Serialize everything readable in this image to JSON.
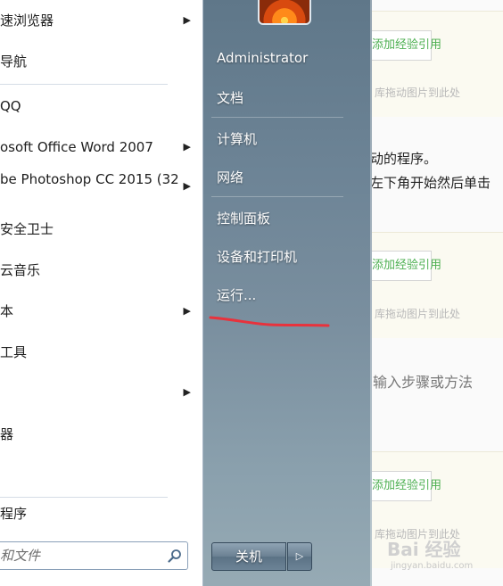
{
  "background": {
    "add_experience_label": "添加经验引用",
    "drag_hint": "库拖动图片到此处",
    "step1_line1": "在运行启动的程序。",
    "step1_line2": "单击桌面左下角开始然后单击",
    "step_placeholder": "输入步骤或方法",
    "watermark_main": "Bai 经验",
    "watermark_sub": "jingyan.baidu.com"
  },
  "start_menu": {
    "programs": [
      {
        "label": "速浏览器",
        "has_submenu": true
      },
      {
        "label": "导航",
        "has_submenu": false
      },
      {
        "label": "QQ",
        "has_submenu": false
      },
      {
        "label": "osoft Office Word 2007",
        "has_submenu": true
      },
      {
        "label": "be Photoshop CC 2015 (32",
        "has_submenu": true
      },
      {
        "label": "安全卫士",
        "has_submenu": false
      },
      {
        "label": "云音乐",
        "has_submenu": false
      },
      {
        "label": "本",
        "has_submenu": true
      },
      {
        "label": "工具",
        "has_submenu": false
      },
      {
        "label": "",
        "has_submenu": true
      },
      {
        "label": "器",
        "has_submenu": false
      },
      {
        "label": "程序",
        "has_submenu": false
      }
    ],
    "submenu_arrow": "▶",
    "search": {
      "placeholder": "和文件"
    },
    "links": {
      "user": "Administrator",
      "documents": "文档",
      "computer": "计算机",
      "network": "网络",
      "control_panel": "控制面板",
      "devices_printers": "设备和打印机",
      "run": "运行..."
    },
    "shutdown": {
      "label": "关机",
      "options_arrow": "▷"
    },
    "annotation_color": "#e8323c"
  }
}
